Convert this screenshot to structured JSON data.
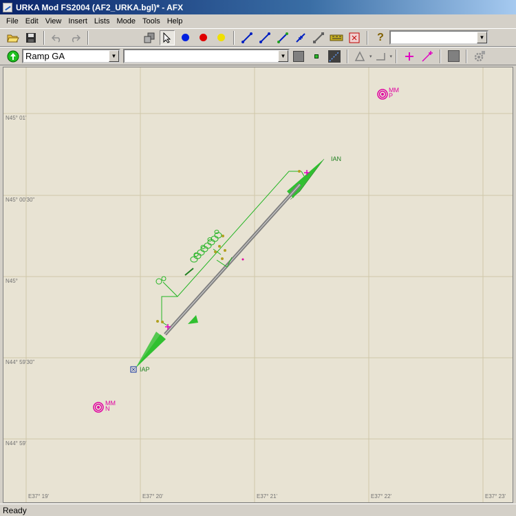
{
  "window": {
    "title": "URKA Mod FS2004 (AF2_URKA.bgl)* - AFX"
  },
  "menu": [
    "File",
    "Edit",
    "View",
    "Insert",
    "Lists",
    "Mode",
    "Tools",
    "Help"
  ],
  "toolbar": {
    "search_combo_value": "",
    "help_glyph": "?"
  },
  "toolbar2": {
    "object_type_value": "Ramp GA",
    "object_name_value": ""
  },
  "map": {
    "lat_labels": [
      "N45° 01'",
      "N45° 00'30\"",
      "N45°",
      "N44° 59'30\"",
      "N44° 59'"
    ],
    "lon_labels": [
      "E37° 19'",
      "E37° 20'",
      "E37° 21'",
      "E37° 22'",
      "E37° 23'"
    ],
    "markers": [
      {
        "id": "mm_p",
        "line1": "MM",
        "line2": "P"
      },
      {
        "id": "mm_n",
        "line1": "MM",
        "line2": "N"
      }
    ],
    "ils_labels": {
      "north": "IAN",
      "south": "IAP"
    },
    "colors": {
      "taxiway": "#22b422",
      "runway": "#808080",
      "marker": "#e000a0",
      "ils": "#30c030"
    }
  },
  "status": {
    "text": "Ready"
  }
}
